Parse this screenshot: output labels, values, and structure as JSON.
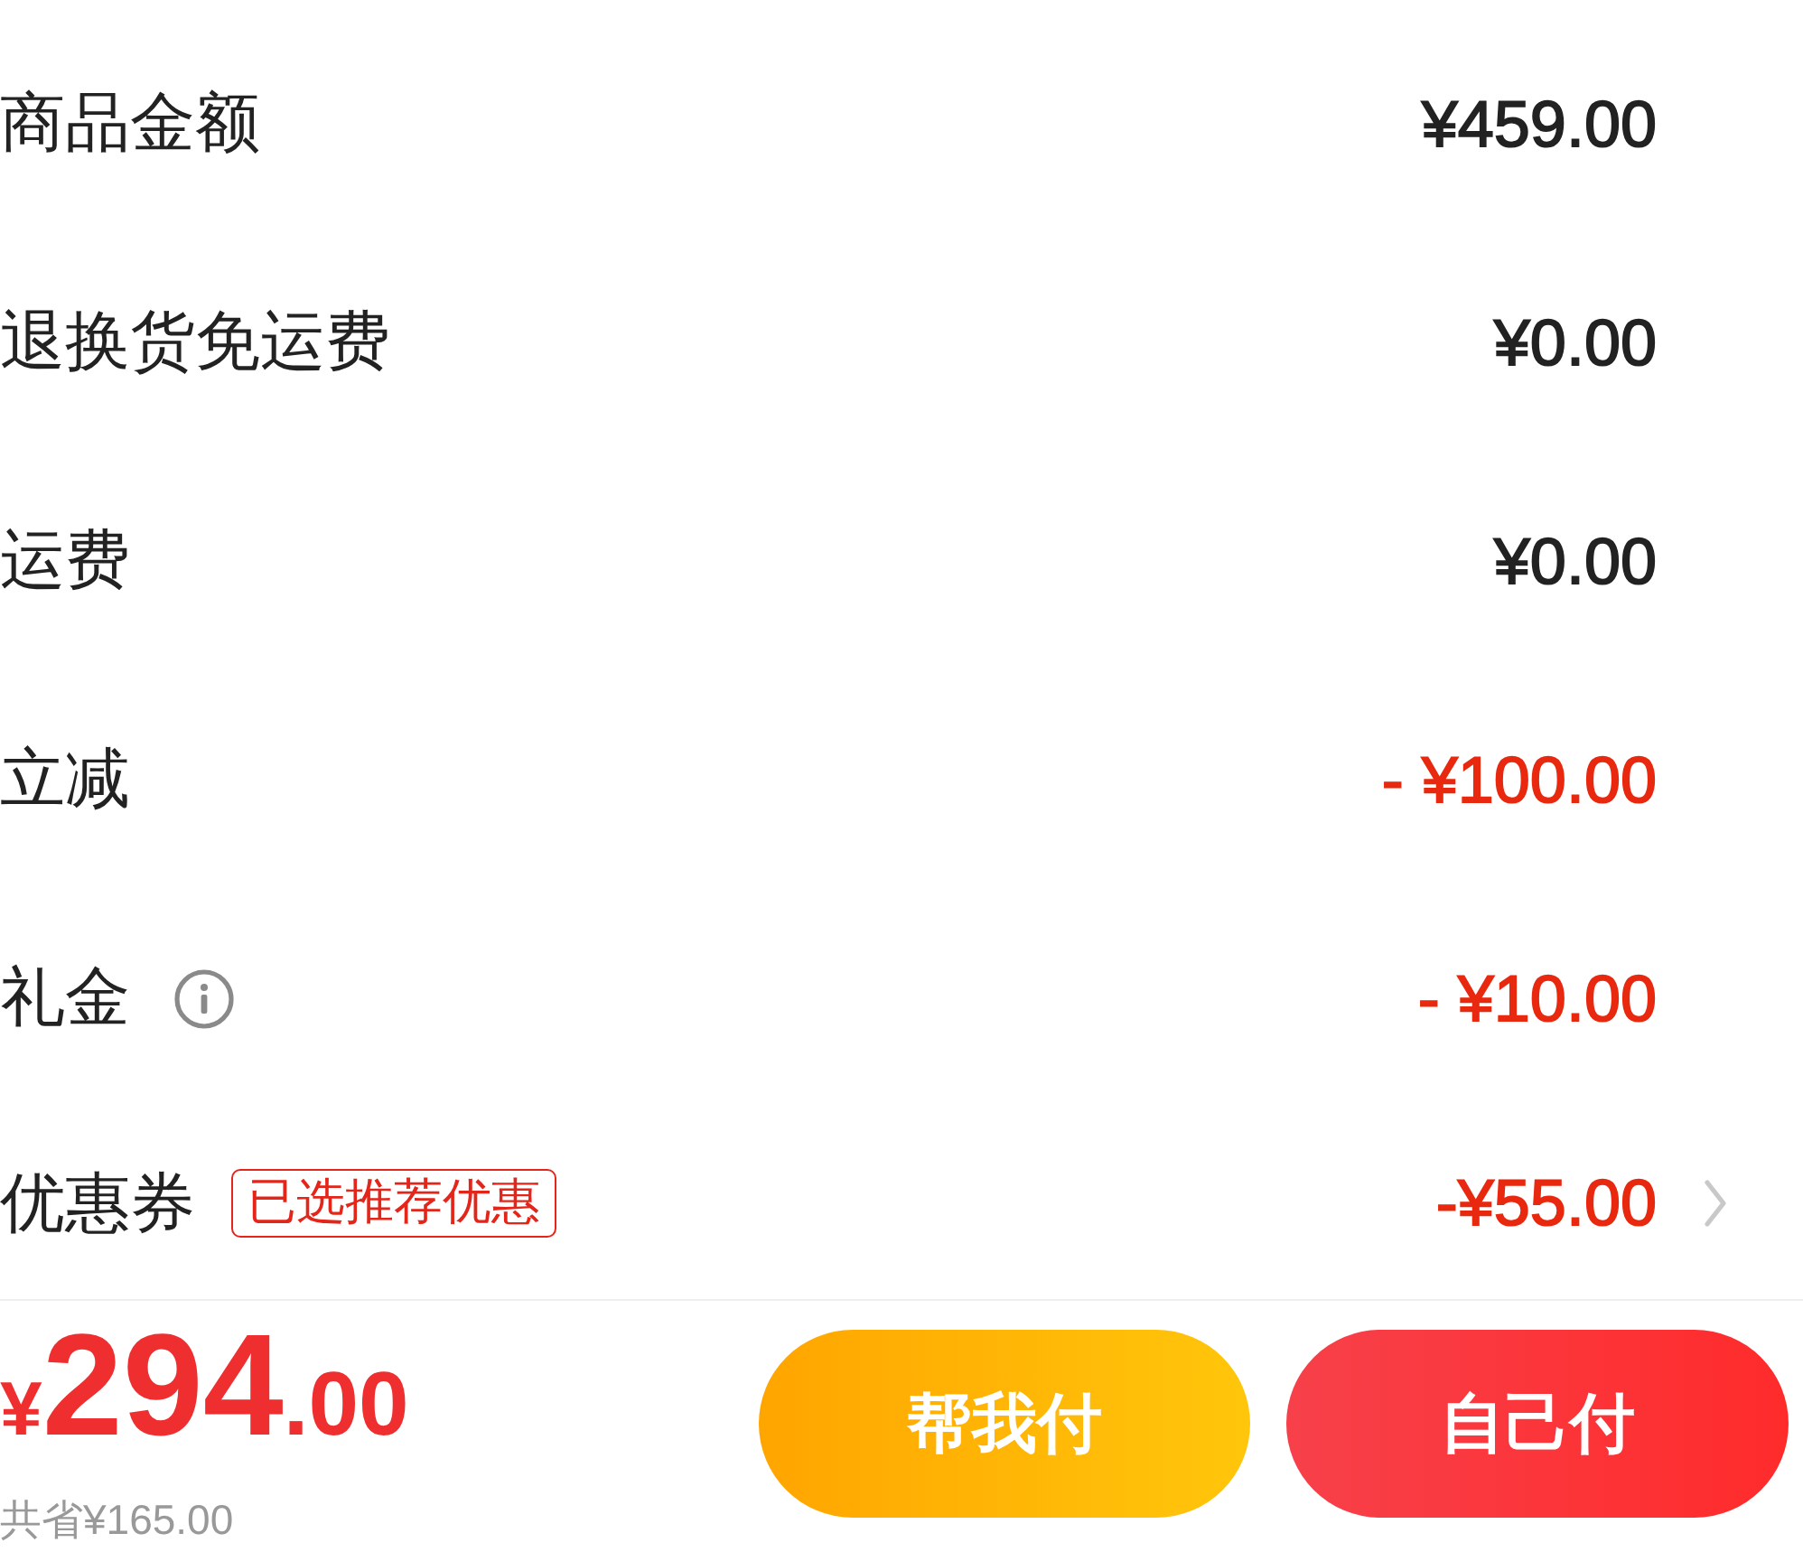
{
  "fee_rows": [
    {
      "label": "商品金额",
      "value": "¥459.00",
      "kind": "plain"
    },
    {
      "label": "退换货免运费",
      "value": "¥0.00",
      "kind": "plain"
    },
    {
      "label": "运费",
      "value": "¥0.00",
      "kind": "plain"
    },
    {
      "label": "立减",
      "value": "- ¥100.00",
      "kind": "discount"
    },
    {
      "label": "礼金",
      "value": "- ¥10.00",
      "kind": "discount",
      "info": true
    },
    {
      "label": "优惠券",
      "tag": "已选推荐优惠",
      "value": "-¥55.00",
      "kind": "discount",
      "chevron": true
    }
  ],
  "total": {
    "price": "¥294.00",
    "savings": "共省¥165.00"
  },
  "buttons": [
    {
      "label": "帮我付",
      "kind": "secondary"
    },
    {
      "label": "自己付",
      "kind": "primary"
    }
  ]
}
